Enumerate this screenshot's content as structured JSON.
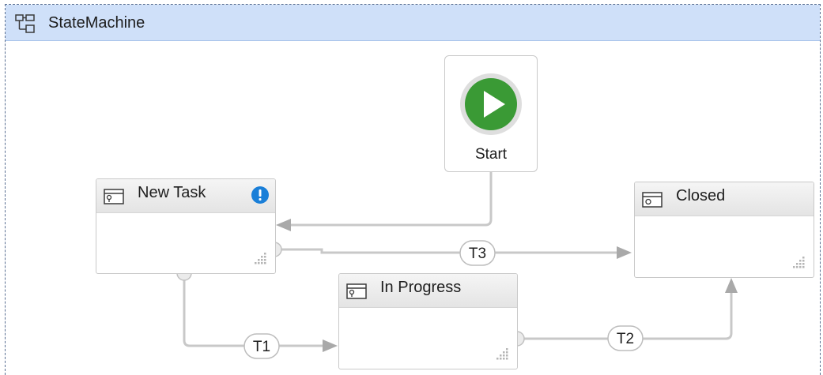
{
  "designer": {
    "title": "StateMachine",
    "icon": "state-machine-icon"
  },
  "start_node": {
    "label": "Start",
    "icon": "play-icon",
    "color": "#3a9a35"
  },
  "states": {
    "new_task": {
      "name": "New Task",
      "icon": "state-icon",
      "has_warning": true,
      "warning_icon": "exclamation-info-icon",
      "warning_color": "#1a7fd8"
    },
    "in_progress": {
      "name": "In Progress",
      "icon": "state-icon"
    },
    "closed": {
      "name": "Closed",
      "icon": "final-state-icon"
    }
  },
  "transitions": {
    "t1": {
      "label": "T1",
      "from": "New Task",
      "to": "In Progress"
    },
    "t2": {
      "label": "T2",
      "from": "In Progress",
      "to": "Closed"
    },
    "t3": {
      "label": "T3",
      "from": "New Task",
      "to": "Closed"
    }
  },
  "colors": {
    "titlebar": "#cfe0f9",
    "connector": "#c8c8c8",
    "arrowhead": "#a9a9a9"
  }
}
